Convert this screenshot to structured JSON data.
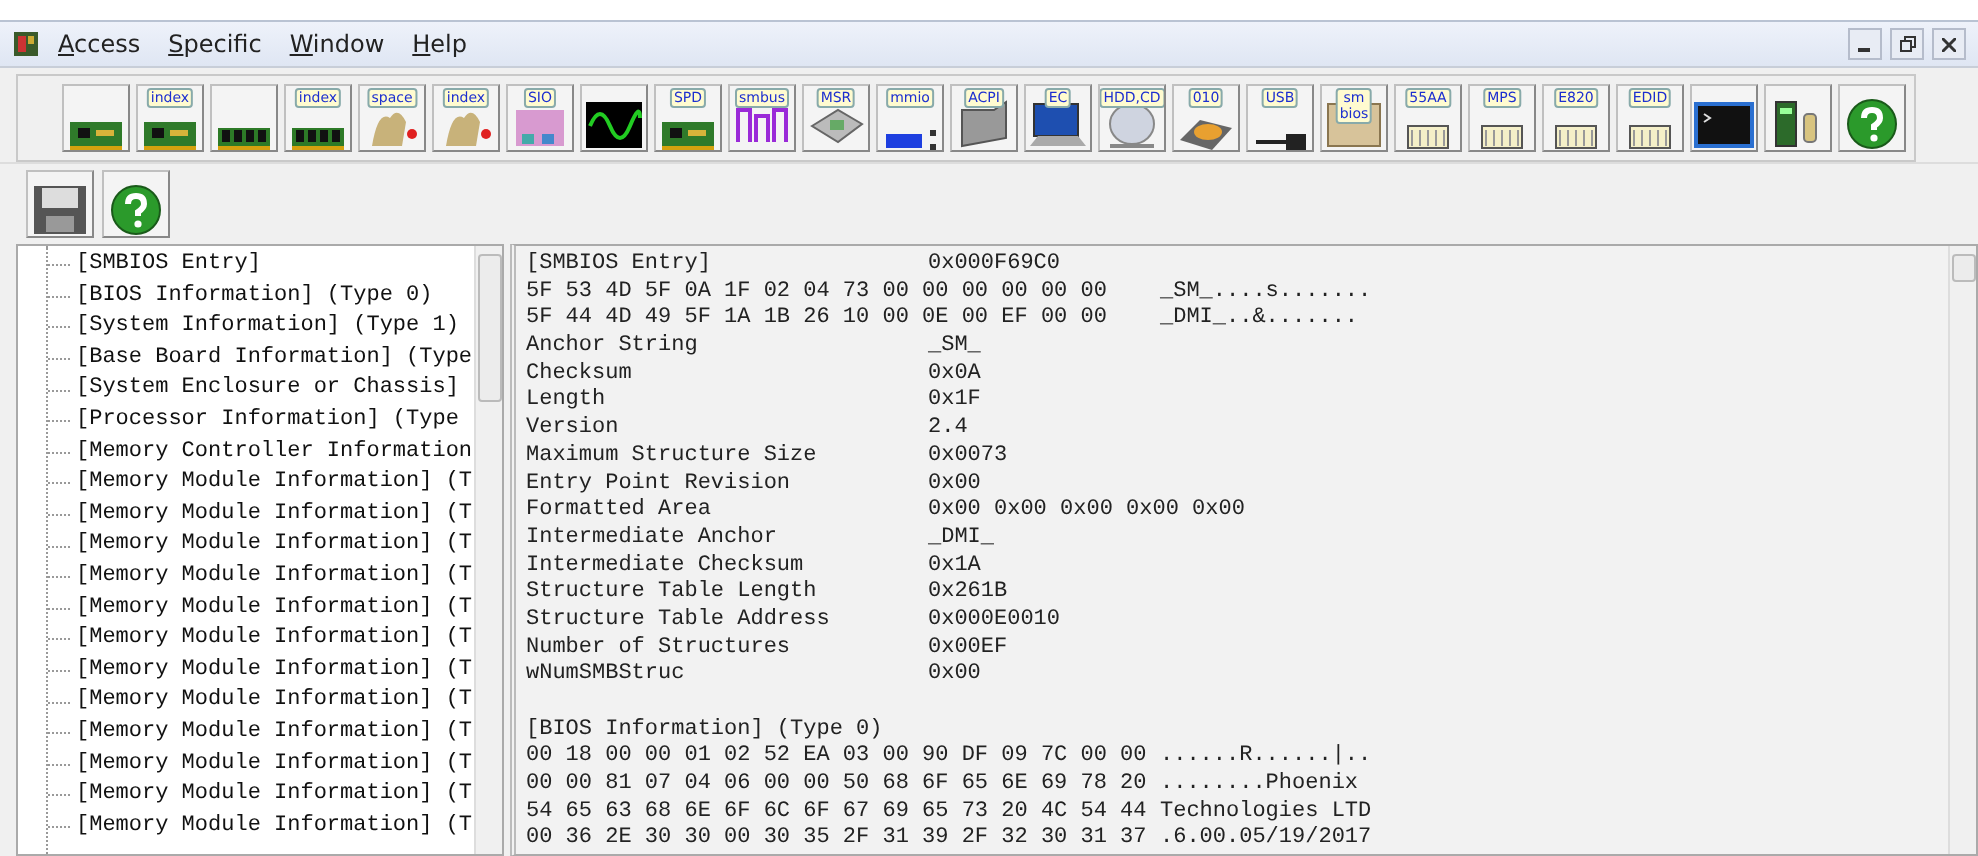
{
  "menu": [
    {
      "label": "Access"
    },
    {
      "label": "Specific"
    },
    {
      "label": "Window"
    },
    {
      "label": "Help"
    }
  ],
  "toolbar": [
    {
      "kind": "card"
    },
    {
      "kind": "card",
      "label": "index"
    },
    {
      "kind": "ram"
    },
    {
      "kind": "ram",
      "label": "index"
    },
    {
      "kind": "pci",
      "label": "space"
    },
    {
      "kind": "pci",
      "label": "index"
    },
    {
      "kind": "chip",
      "label": "SIO"
    },
    {
      "kind": "scope"
    },
    {
      "kind": "card",
      "label": "SPD"
    },
    {
      "kind": "bus",
      "label": "smbus"
    },
    {
      "kind": "cpu",
      "label": "MSR"
    },
    {
      "kind": "bar",
      "label": "mmio"
    },
    {
      "kind": "folder",
      "label": "ACPI"
    },
    {
      "kind": "laptop",
      "label": "EC"
    },
    {
      "kind": "disc",
      "label": "HDD,CD"
    },
    {
      "kind": "drive",
      "label": "010"
    },
    {
      "kind": "usb",
      "label": "USB"
    },
    {
      "kind": "box",
      "label": "sm bios"
    },
    {
      "kind": "rom",
      "label": "55AA"
    },
    {
      "kind": "rom",
      "label": "MPS"
    },
    {
      "kind": "rom",
      "label": "E820"
    },
    {
      "kind": "rom",
      "label": "EDID"
    },
    {
      "kind": "terminal"
    },
    {
      "kind": "tower"
    },
    {
      "kind": "help"
    }
  ],
  "toolbar2": [
    {
      "kind": "save"
    },
    {
      "kind": "help"
    }
  ],
  "tree": [
    "[SMBIOS Entry]",
    "[BIOS Information] (Type 0)",
    "[System Information] (Type 1)",
    "[Base Board Information] (Type",
    "[System Enclosure or Chassis]",
    "[Processor Information] (Type",
    "[Memory Controller Information",
    "[Memory Module Information] (T",
    "[Memory Module Information] (T",
    "[Memory Module Information] (T",
    "[Memory Module Information] (T",
    "[Memory Module Information] (T",
    "[Memory Module Information] (T",
    "[Memory Module Information] (T",
    "[Memory Module Information] (T",
    "[Memory Module Information] (T",
    "[Memory Module Information] (T",
    "[Memory Module Information] (T",
    "[Memory Module Information] (T"
  ],
  "detail": [
    {
      "kind": "field",
      "name": "[SMBIOS Entry]",
      "value": "0x000F69C0"
    },
    {
      "kind": "hex",
      "bytes": "5F 53 4D 5F 0A 1F 02 04 73 00 00 00 00 00 00",
      "ascii": "_SM_....s......."
    },
    {
      "kind": "hex",
      "bytes": "5F 44 4D 49 5F 1A 1B 26 10 00 0E 00 EF 00 00",
      "ascii": "_DMI_..&......."
    },
    {
      "kind": "field",
      "name": "Anchor String",
      "value": "_SM_"
    },
    {
      "kind": "field",
      "name": "Checksum",
      "value": "0x0A"
    },
    {
      "kind": "field",
      "name": "Length",
      "value": "0x1F"
    },
    {
      "kind": "field",
      "name": "Version",
      "value": "2.4"
    },
    {
      "kind": "field",
      "name": "Maximum Structure Size",
      "value": "0x0073"
    },
    {
      "kind": "field",
      "name": "Entry Point Revision",
      "value": "0x00"
    },
    {
      "kind": "field",
      "name": "Formatted Area",
      "value": "0x00 0x00 0x00 0x00 0x00"
    },
    {
      "kind": "field",
      "name": "Intermediate Anchor",
      "value": "_DMI_"
    },
    {
      "kind": "field",
      "name": "Intermediate Checksum",
      "value": "0x1A"
    },
    {
      "kind": "field",
      "name": "Structure Table Length",
      "value": "0x261B"
    },
    {
      "kind": "field",
      "name": "Structure Table Address",
      "value": "0x000E0010"
    },
    {
      "kind": "field",
      "name": "Number of Structures",
      "value": "0x00EF"
    },
    {
      "kind": "field",
      "name": "wNumSMBStruc",
      "value": "0x00"
    },
    {
      "kind": "blank"
    },
    {
      "kind": "heading",
      "text": "[BIOS Information] (Type 0)"
    },
    {
      "kind": "hex",
      "bytes": "00 18 00 00 01 02 52 EA 03 00 90 DF 09 7C 00 00",
      "ascii": "......R......|.."
    },
    {
      "kind": "hex",
      "bytes": "00 00 81 07 04 06 00 00 50 68 6F 65 6E 69 78 20",
      "ascii": "........Phoenix"
    },
    {
      "kind": "hex",
      "bytes": "54 65 63 68 6E 6F 6C 6F 67 69 65 73 20 4C 54 44",
      "ascii": "Technologies LTD"
    },
    {
      "kind": "hex",
      "bytes": "00 36 2E 30 30 00 30 35 2F 31 39 2F 32 30 31 37",
      "ascii": ".6.00.05/19/2017"
    }
  ]
}
